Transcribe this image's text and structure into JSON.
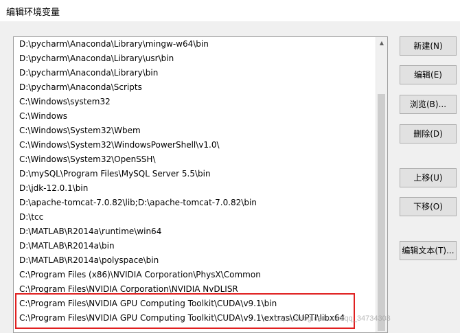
{
  "window": {
    "title": "编辑环境变量"
  },
  "paths": [
    "D:\\pycharm\\Anaconda\\Library\\mingw-w64\\bin",
    "D:\\pycharm\\Anaconda\\Library\\usr\\bin",
    "D:\\pycharm\\Anaconda\\Library\\bin",
    "D:\\pycharm\\Anaconda\\Scripts",
    "C:\\Windows\\system32",
    "C:\\Windows",
    "C:\\Windows\\System32\\Wbem",
    "C:\\Windows\\System32\\WindowsPowerShell\\v1.0\\",
    "C:\\Windows\\System32\\OpenSSH\\",
    "D:\\mySQL\\Program Files\\MySQL Server 5.5\\bin",
    "D:\\jdk-12.0.1\\bin",
    "D:\\apache-tomcat-7.0.82\\lib;D:\\apache-tomcat-7.0.82\\bin",
    "D:\\tcc",
    "D:\\MATLAB\\R2014a\\runtime\\win64",
    "D:\\MATLAB\\R2014a\\bin",
    "D:\\MATLAB\\R2014a\\polyspace\\bin",
    "C:\\Program Files (x86)\\NVIDIA Corporation\\PhysX\\Common",
    "C:\\Program Files\\NVIDIA Corporation\\NVIDIA NvDLISR",
    "C:\\Program Files\\NVIDIA GPU Computing Toolkit\\CUDA\\v9.1\\bin",
    "C:\\Program Files\\NVIDIA GPU Computing Toolkit\\CUDA\\v9.1\\extras\\CUPTI\\libx64"
  ],
  "buttons": {
    "new": "新建(N)",
    "edit": "编辑(E)",
    "browse": "浏览(B)...",
    "delete": "删除(D)",
    "move_up": "上移(U)",
    "move_down": "下移(O)",
    "edit_text": "编辑文本(T)..."
  },
  "icons": {
    "scroll_up": "chevron-up-icon"
  },
  "colors": {
    "highlight_border": "#e02020"
  },
  "watermark": "https://blog.csdn.net/qq_34734303"
}
